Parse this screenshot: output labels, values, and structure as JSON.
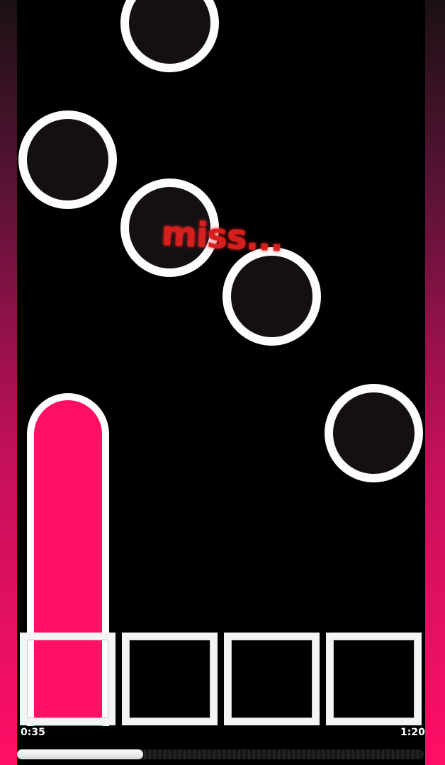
{
  "game": {
    "judgement_text": "miss...",
    "time_current": "0:35",
    "time_total": "1:20",
    "progress_fraction": 0.31
  },
  "colors": {
    "accent": "#ff0f66",
    "miss": "#d7201e",
    "note_fill": "#141012",
    "note_outline": "#fdfdfd",
    "background": "#000000"
  },
  "lanes": [
    {
      "name": "lane-1",
      "active": true
    },
    {
      "name": "lane-2",
      "active": false
    },
    {
      "name": "lane-3",
      "active": false
    },
    {
      "name": "lane-4",
      "active": false
    }
  ]
}
